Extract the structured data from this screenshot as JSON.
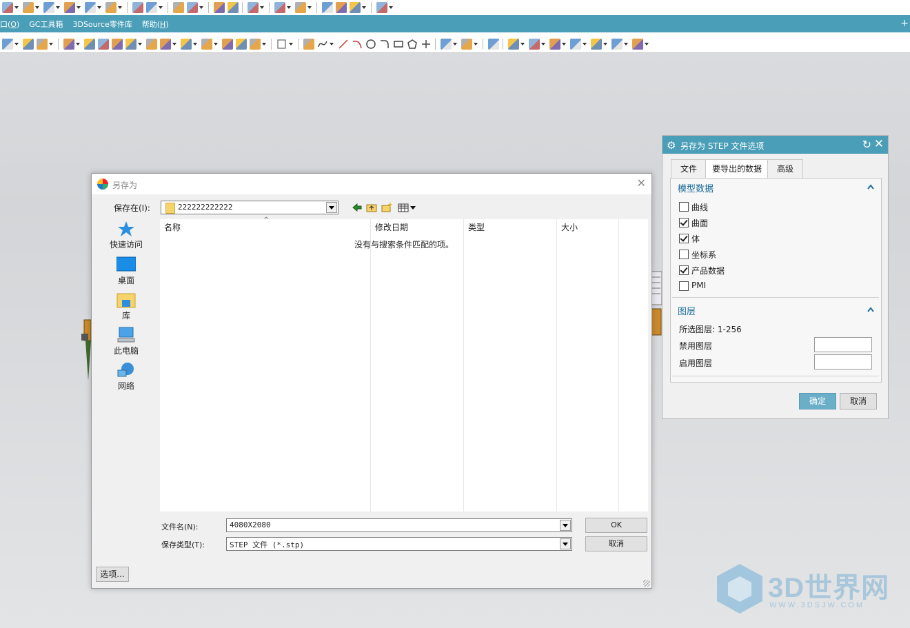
{
  "menubar": {
    "items": [
      {
        "label": "口(",
        "key": "O",
        "tail": ")"
      },
      {
        "label": "GC工具箱",
        "key": "",
        "tail": ""
      },
      {
        "label": "3DSource零件库",
        "key": "",
        "tail": ""
      },
      {
        "label": "帮助(",
        "key": "H",
        "tail": ")"
      }
    ],
    "pin": "+"
  },
  "save_dialog": {
    "title": "另存为",
    "close": "✕",
    "save_in_label": "保存在(I):",
    "folder": "222222222222",
    "places": [
      "快速访问",
      "桌面",
      "库",
      "此电脑",
      "网络"
    ],
    "columns": [
      "名称",
      "修改日期",
      "类型",
      "大小"
    ],
    "empty_message": "没有与搜索条件匹配的项。",
    "filename_label": "文件名(N):",
    "filename_value": "4080X2080",
    "filetype_label": "保存类型(T):",
    "filetype_value": "STEP 文件 (*.stp)",
    "ok": "OK",
    "cancel": "取消",
    "options": "选项..."
  },
  "step_dialog": {
    "title": "另存为 STEP 文件选项",
    "tabs": [
      "文件",
      "要导出的数据",
      "高级"
    ],
    "active_tab": "要导出的数据",
    "model_section": "模型数据",
    "model_items": [
      {
        "label": "曲线",
        "checked": false
      },
      {
        "label": "曲面",
        "checked": true
      },
      {
        "label": "体",
        "checked": true
      },
      {
        "label": "坐标系",
        "checked": false
      },
      {
        "label": "产品数据",
        "checked": true
      },
      {
        "label": "PMI",
        "checked": false
      }
    ],
    "layer_section": "图层",
    "selected_layers": "所选图层: 1-256",
    "disabled_layers_label": "禁用图层",
    "enabled_layers_label": "启用图层",
    "ok": "确定",
    "cancel": "取消"
  },
  "colors": {
    "accent": "#4a9eb8",
    "ok_button": "#6aaec8",
    "section_text": "#1f6e9c"
  },
  "watermark": {
    "text": "3D世界网",
    "url": "WWW.3DSJW.COM"
  }
}
